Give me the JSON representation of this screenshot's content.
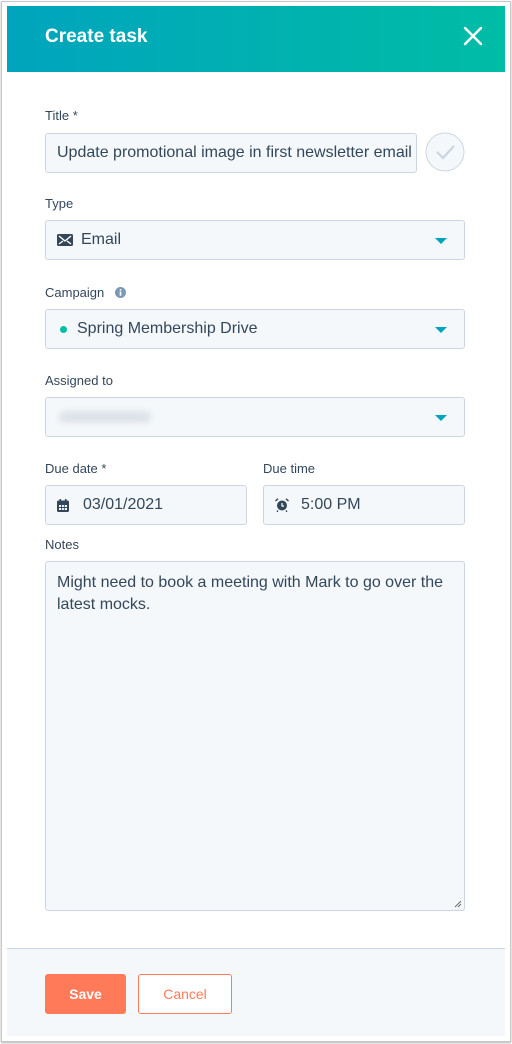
{
  "header": {
    "title": "Create task",
    "close_icon": "close-icon"
  },
  "form": {
    "title_label": "Title *",
    "title_value": "Update promotional image in first newsletter email",
    "type_label": "Type",
    "type_value": "Email",
    "campaign_label": "Campaign",
    "campaign_value": "Spring Membership Drive",
    "campaign_dot_color": "#00bda5",
    "assigned_label": "Assigned to",
    "due_date_label": "Due date *",
    "due_date_value": "03/01/2021",
    "due_time_label": "Due time",
    "due_time_value": "5:00 PM",
    "notes_label": "Notes",
    "notes_value": "Might need to book a meeting with Mark to go over the latest mocks."
  },
  "footer": {
    "save_label": "Save",
    "cancel_label": "Cancel"
  },
  "colors": {
    "accent": "#00a4bd",
    "primary_button": "#ff7a59"
  }
}
